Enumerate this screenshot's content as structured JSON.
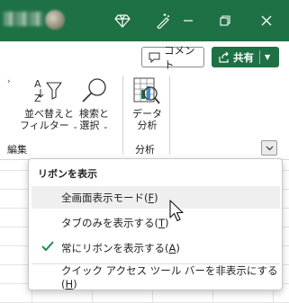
{
  "titlebar": {
    "icons": [
      "diamond-icon",
      "magic-wand-icon",
      "minimize-icon",
      "restore-icon",
      "close-icon"
    ]
  },
  "ribbon_top": {
    "comment_label": "コメント",
    "share_label": "共有"
  },
  "ribbon": {
    "sort_filter_label_1": "並べ替えと",
    "sort_filter_label_2": "フィルター",
    "find_select_label_1": "検索と",
    "find_select_label_2": "選択",
    "data_analysis_label_1": "データ",
    "data_analysis_label_2": "分析",
    "group_edit_label": "編集",
    "group_analysis_label": "分析"
  },
  "menu": {
    "header": "リボンを表示",
    "items": [
      {
        "label_prefix": "全画面表示モード(",
        "accel": "F",
        "label_suffix": ")"
      },
      {
        "label_prefix": "タブのみを表示する(",
        "accel": "T",
        "label_suffix": ")"
      },
      {
        "label_prefix": "常にリボンを表示する(",
        "accel": "A",
        "label_suffix": ")"
      },
      {
        "label_prefix": "クイック アクセス ツール バーを非表示にする (",
        "accel": "H",
        "label_suffix": ")"
      }
    ]
  },
  "colors": {
    "accent": "#1e7145",
    "check": "#1e8c4d",
    "hover": "#efefef"
  }
}
